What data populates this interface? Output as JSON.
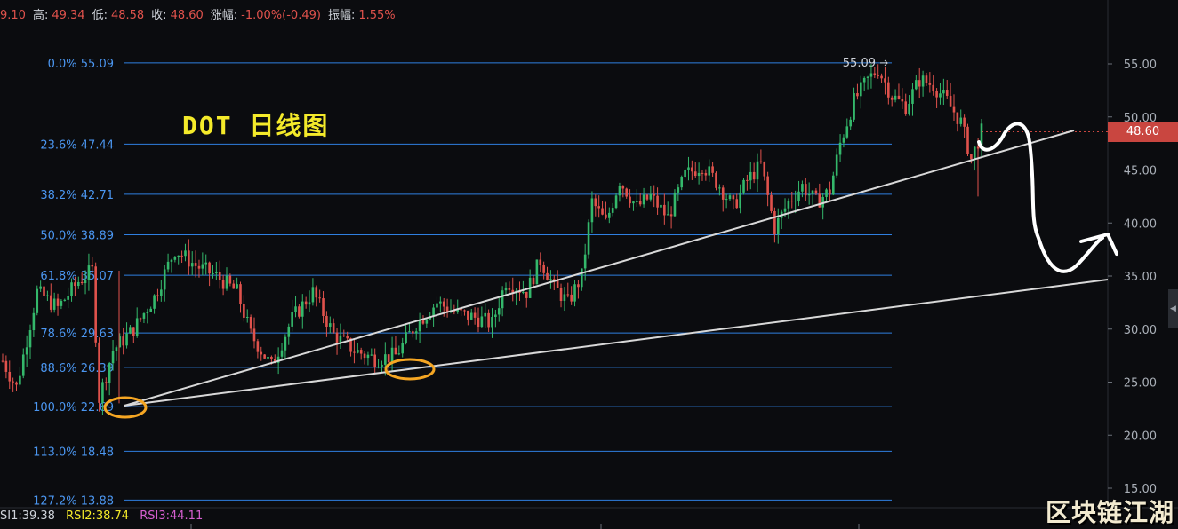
{
  "header": {
    "items": [
      {
        "label": "",
        "value": "9.10"
      },
      {
        "label": "高:",
        "value": "49.34"
      },
      {
        "label": "低:",
        "value": "48.58"
      },
      {
        "label": "收:",
        "value": "48.60"
      },
      {
        "label": "涨幅:",
        "value": "-1.00%(-0.49)"
      },
      {
        "label": "振幅:",
        "value": "1.55%"
      }
    ]
  },
  "indicator": {
    "rsi1": {
      "label": "SI1:39.38",
      "color": "#cfd3da"
    },
    "rsi2": {
      "label": "RSI2:38.74",
      "color": "#f4ea2a"
    },
    "rsi3": {
      "label": "RSI3:44.11",
      "color": "#d65fd0"
    }
  },
  "overlay": {
    "title": "DOT 日线图",
    "watermark": "区块链江湖",
    "current_price": "48.60"
  },
  "colors": {
    "background": "#0b0c0f",
    "fib_line": "#2f7fe0",
    "fib_label": "#4b96f0",
    "up_candle": "#34b86b",
    "down_candle": "#e0524c",
    "trendline": "#d8d8d8",
    "circle": "#f5a623",
    "price_tag": "#c94640"
  },
  "chart_data": {
    "type": "candlestick",
    "yaxis": {
      "ticks": [
        "55.00",
        "50.00",
        "45.00",
        "40.00",
        "35.00",
        "30.00",
        "25.00",
        "20.00",
        "15.00"
      ],
      "ylim": [
        13.0,
        58.0
      ]
    },
    "fibonacci": [
      {
        "label": "0.0% 55.09",
        "value": 55.09
      },
      {
        "label": "23.6% 47.44",
        "value": 47.44
      },
      {
        "label": "38.2% 42.71",
        "value": 42.71
      },
      {
        "label": "50.0% 38.89",
        "value": 38.89
      },
      {
        "label": "61.8% 35.07",
        "value": 35.07
      },
      {
        "label": "78.6% 29.63",
        "value": 29.63
      },
      {
        "label": "88.6% 26.39",
        "value": 26.39
      },
      {
        "label": "100.0% 22.69",
        "value": 22.69
      },
      {
        "label": "113.0% 18.48",
        "value": 18.48
      },
      {
        "label": "127.2% 13.88",
        "value": 13.88
      }
    ],
    "high_marker": "55.09",
    "price_path": [
      {
        "i": 0,
        "p": 27.0
      },
      {
        "i": 4,
        "p": 24.5
      },
      {
        "i": 10,
        "p": 33.5
      },
      {
        "i": 16,
        "p": 32.0
      },
      {
        "i": 22,
        "p": 34.5
      },
      {
        "i": 26,
        "p": 35.5
      },
      {
        "i": 28,
        "p": 23.5
      },
      {
        "i": 32,
        "p": 28.0
      },
      {
        "i": 38,
        "p": 30.0
      },
      {
        "i": 44,
        "p": 33.0
      },
      {
        "i": 50,
        "p": 37.5
      },
      {
        "i": 56,
        "p": 36.0
      },
      {
        "i": 62,
        "p": 35.0
      },
      {
        "i": 68,
        "p": 33.5
      },
      {
        "i": 72,
        "p": 29.5
      },
      {
        "i": 78,
        "p": 26.5
      },
      {
        "i": 84,
        "p": 31.0
      },
      {
        "i": 90,
        "p": 33.5
      },
      {
        "i": 96,
        "p": 29.5
      },
      {
        "i": 102,
        "p": 28.0
      },
      {
        "i": 108,
        "p": 27.2
      },
      {
        "i": 114,
        "p": 27.5
      },
      {
        "i": 120,
        "p": 30.5
      },
      {
        "i": 126,
        "p": 32.5
      },
      {
        "i": 132,
        "p": 31.5
      },
      {
        "i": 138,
        "p": 31.0
      },
      {
        "i": 142,
        "p": 30.5
      },
      {
        "i": 146,
        "p": 34.5
      },
      {
        "i": 152,
        "p": 33.5
      },
      {
        "i": 156,
        "p": 36.5
      },
      {
        "i": 160,
        "p": 34.0
      },
      {
        "i": 164,
        "p": 32.5
      },
      {
        "i": 168,
        "p": 35.0
      },
      {
        "i": 171,
        "p": 42.0
      },
      {
        "i": 175,
        "p": 40.0
      },
      {
        "i": 179,
        "p": 44.0
      },
      {
        "i": 184,
        "p": 41.5
      },
      {
        "i": 188,
        "p": 42.5
      },
      {
        "i": 193,
        "p": 40.5
      },
      {
        "i": 198,
        "p": 44.5
      },
      {
        "i": 203,
        "p": 45.5
      },
      {
        "i": 208,
        "p": 43.5
      },
      {
        "i": 212,
        "p": 41.5
      },
      {
        "i": 216,
        "p": 44.0
      },
      {
        "i": 220,
        "p": 45.5
      },
      {
        "i": 224,
        "p": 39.5
      },
      {
        "i": 228,
        "p": 42.0
      },
      {
        "i": 232,
        "p": 43.5
      },
      {
        "i": 236,
        "p": 42.0
      },
      {
        "i": 240,
        "p": 43.0
      },
      {
        "i": 243,
        "p": 47.5
      },
      {
        "i": 247,
        "p": 51.5
      },
      {
        "i": 251,
        "p": 53.5
      },
      {
        "i": 254,
        "p": 54.5
      },
      {
        "i": 258,
        "p": 52.0
      },
      {
        "i": 262,
        "p": 51.0
      },
      {
        "i": 266,
        "p": 53.5
      },
      {
        "i": 270,
        "p": 53.0
      },
      {
        "i": 274,
        "p": 51.5
      },
      {
        "i": 278,
        "p": 49.5
      },
      {
        "i": 281,
        "p": 46.0
      },
      {
        "i": 284,
        "p": 48.6
      }
    ],
    "last_price": 48.6
  }
}
